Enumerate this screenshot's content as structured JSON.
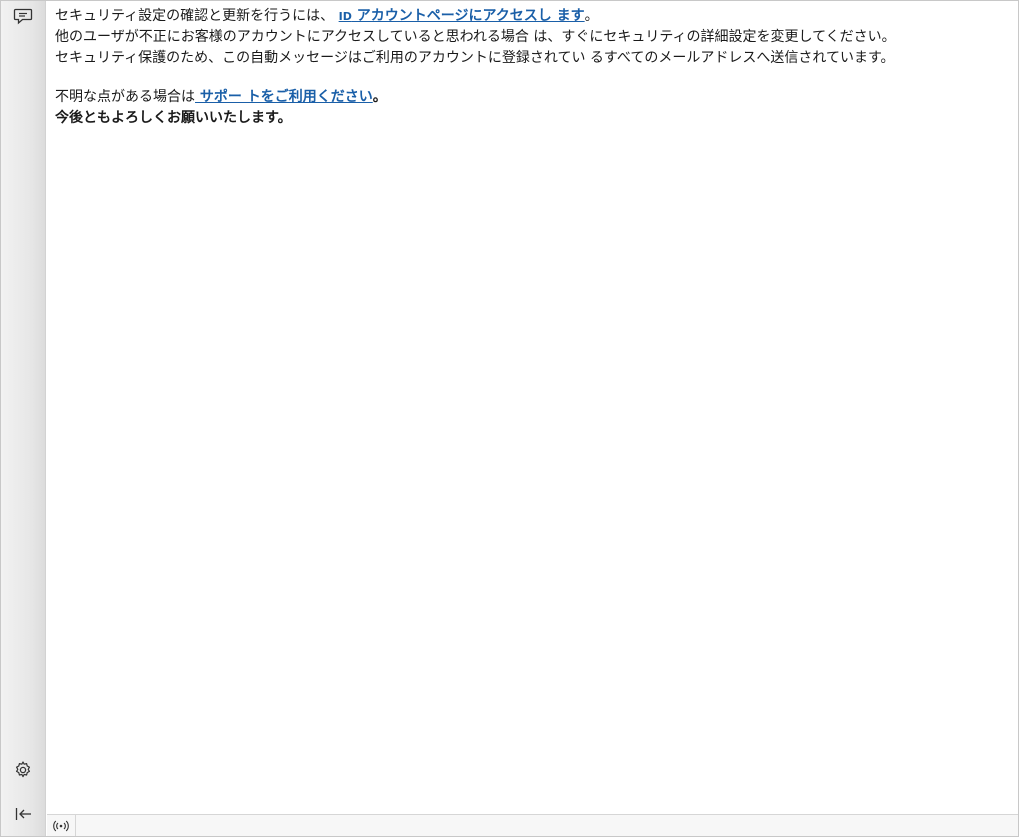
{
  "sidebar": {
    "top_icon": "chat-bubble-icon",
    "settings_icon": "gear-icon",
    "collapse_icon": "collapse-left-icon"
  },
  "message": {
    "line1_prefix": "セキュリティ設定の確認と更新を行うには、",
    "line1_link_small": "ID",
    "line1_link_main": " アカウントページにアクセスし ます",
    "line1_suffix": "。",
    "line2": "他のユーザが不正にお客様のアカウントにアクセスしていると思われる場合 は、すぐにセキュリティの詳細設定を変更してください。",
    "line3": "セキュリティ保護のため、この自動メッセージはご利用のアカウントに登録されてい るすべてのメールアドレスへ送信されています。",
    "line4_prefix": "不明な点がある場合は",
    "line4_link": " サポー トをご利用ください",
    "line4_suffix": "。",
    "closing": "今後ともよろしくお願いいたします。"
  },
  "statusbar": {
    "icon": "wireless-signal-icon"
  },
  "colors": {
    "link": "#1a5fa8",
    "text": "#1a1a1a"
  }
}
